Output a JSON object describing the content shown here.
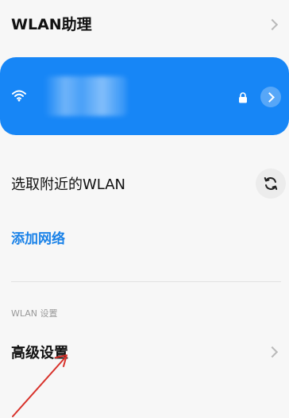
{
  "assistant": {
    "title": "WLAN助理"
  },
  "connected_card": {
    "network_name": "",
    "icons": [
      "wifi-icon",
      "lock-icon",
      "chevron-right-icon"
    ],
    "color": "#1786f6"
  },
  "nearby": {
    "label": "选取附近的WLAN",
    "refresh_icon": "refresh-icon"
  },
  "add_network": {
    "label": "添加网络",
    "color": "#1a82e8"
  },
  "settings_section": {
    "header": "WLAN 设置",
    "items": [
      {
        "label": "高级设置"
      }
    ]
  },
  "annotation": {
    "color": "#d8322b"
  }
}
